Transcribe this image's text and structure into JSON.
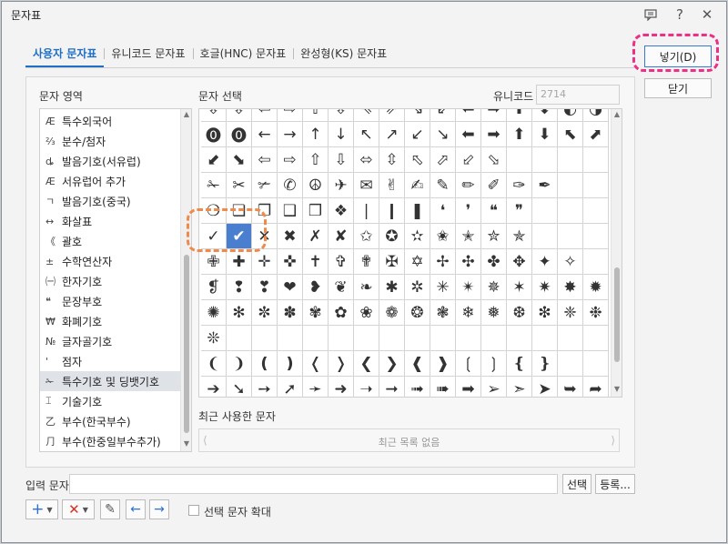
{
  "window": {
    "title": "문자표"
  },
  "tabs": [
    {
      "label": "사용자 문자표",
      "active": true
    },
    {
      "label": "유니코드 문자표"
    },
    {
      "label": "호글(HNC) 문자표"
    },
    {
      "label": "완성형(KS) 문자표"
    }
  ],
  "labels": {
    "area": "문자 영역",
    "select": "문자 선택",
    "unicode": "유니코드",
    "recent": "최근 사용한 문자",
    "input": "입력 문자",
    "enlarge": "선택 문자 확대"
  },
  "unicode_value": "2714",
  "recent_empty": "최근 목록 없음",
  "buttons": {
    "insert": "넣기(D)",
    "close": "닫기",
    "select": "선택",
    "register": "등록..."
  },
  "areas": [
    {
      "icon": "Æ",
      "label": "특수외국어"
    },
    {
      "icon": "⅔",
      "label": "분수/첨자"
    },
    {
      "icon": "ȡ",
      "label": "발음기호(서유럽)"
    },
    {
      "icon": "Æ",
      "label": "서유럽어 추가"
    },
    {
      "icon": "ㄱ",
      "label": "발음기호(중국)"
    },
    {
      "icon": "↔",
      "label": "화살표"
    },
    {
      "icon": "《",
      "label": "괄호"
    },
    {
      "icon": "±",
      "label": "수학연산자"
    },
    {
      "icon": "㈠",
      "label": "한자기호"
    },
    {
      "icon": "❝",
      "label": "문장부호"
    },
    {
      "icon": "₩",
      "label": "화폐기호"
    },
    {
      "icon": "№",
      "label": "글자골기호"
    },
    {
      "icon": "'",
      "label": "점자"
    },
    {
      "icon": "✁",
      "label": "특수기호 및 딩뱃기호",
      "selected": true
    },
    {
      "icon": "⌶",
      "label": "기술기호"
    },
    {
      "icon": "乙",
      "label": "부수(한국부수)"
    },
    {
      "icon": "⺆",
      "label": "부수(한중일부수추가)"
    }
  ],
  "symbol_rows": [
    [
      "⇩",
      "⇩",
      "⇦",
      "⇨",
      "⇧",
      "⇩",
      "⇖",
      "⇗",
      "⇘",
      "⇙",
      "⬅",
      "➡",
      "⬆",
      "⬇",
      "◐",
      "◑"
    ],
    [
      "⓿",
      "⓿",
      "←",
      "→",
      "↑",
      "↓",
      "↖",
      "↗",
      "↙",
      "↘",
      "⬅",
      "➡",
      "⬆",
      "⬇",
      "⬉",
      "⬈"
    ],
    [
      "⬋",
      "⬊",
      "⇦",
      "⇨",
      "⇧",
      "⇩",
      "⬄",
      "⇳",
      "⬁",
      "⬀",
      "⬃",
      "⬂",
      "",
      "",
      "",
      ""
    ],
    [
      "✁",
      "✂",
      "✃",
      "✆",
      "☮",
      "✈",
      "✉",
      "✌",
      "✍",
      "✎",
      "✏",
      "✐",
      "✑",
      "✒",
      "",
      ""
    ],
    [
      "❍",
      "❏",
      "❐",
      "❑",
      "❒",
      "❖",
      "❘",
      "❙",
      "❚",
      "❛",
      "❜",
      "❝",
      "❞",
      "",
      "",
      ""
    ],
    [
      "✓",
      "✔",
      "✕",
      "✖",
      "✗",
      "✘",
      "✩",
      "✪",
      "✫",
      "✬",
      "✭",
      "✮",
      "✯",
      "",
      "",
      ""
    ],
    [
      "✙",
      "✚",
      "✛",
      "✜",
      "✝",
      "✞",
      "✟",
      "✠",
      "✡",
      "✢",
      "✣",
      "✤",
      "✥",
      "✦",
      "✧",
      ""
    ],
    [
      "❡",
      "❢",
      "❣",
      "❤",
      "❥",
      "❦",
      "❧",
      "✱",
      "✲",
      "✳",
      "✴",
      "✵",
      "✶",
      "✷",
      "✸",
      "✹"
    ],
    [
      "✺",
      "✻",
      "✼",
      "✽",
      "✾",
      "✿",
      "❀",
      "❁",
      "❂",
      "❃",
      "❄",
      "❅",
      "❆",
      "❇",
      "❈",
      "❉"
    ],
    [
      "❊",
      "",
      "",
      "",
      "",
      "",
      "",
      "",
      "",
      "",
      "",
      "",
      "",
      "",
      "",
      ""
    ],
    [
      "❨",
      "❩",
      "❪",
      "❫",
      "❬",
      "❭",
      "❮",
      "❯",
      "❰",
      "❱",
      "❲",
      "❳",
      "❴",
      "❵",
      "",
      ""
    ],
    [
      "➔",
      "➘",
      "➙",
      "➚",
      "➛",
      "➜",
      "➝",
      "➞",
      "➟",
      "➠",
      "➡",
      "➢",
      "➣",
      "➤",
      "➥",
      "➦"
    ]
  ],
  "selected_symbol": "✔",
  "toolbar_icons": [
    "plus-icon",
    "delete-icon",
    "pencil-icon",
    "left-arrow-icon",
    "right-arrow-icon"
  ],
  "colors": {
    "accent": "#1f6fc4",
    "selection": "#4a7fd0",
    "highlight_pink": "#ee2f86",
    "highlight_orange": "#f08a4a"
  }
}
